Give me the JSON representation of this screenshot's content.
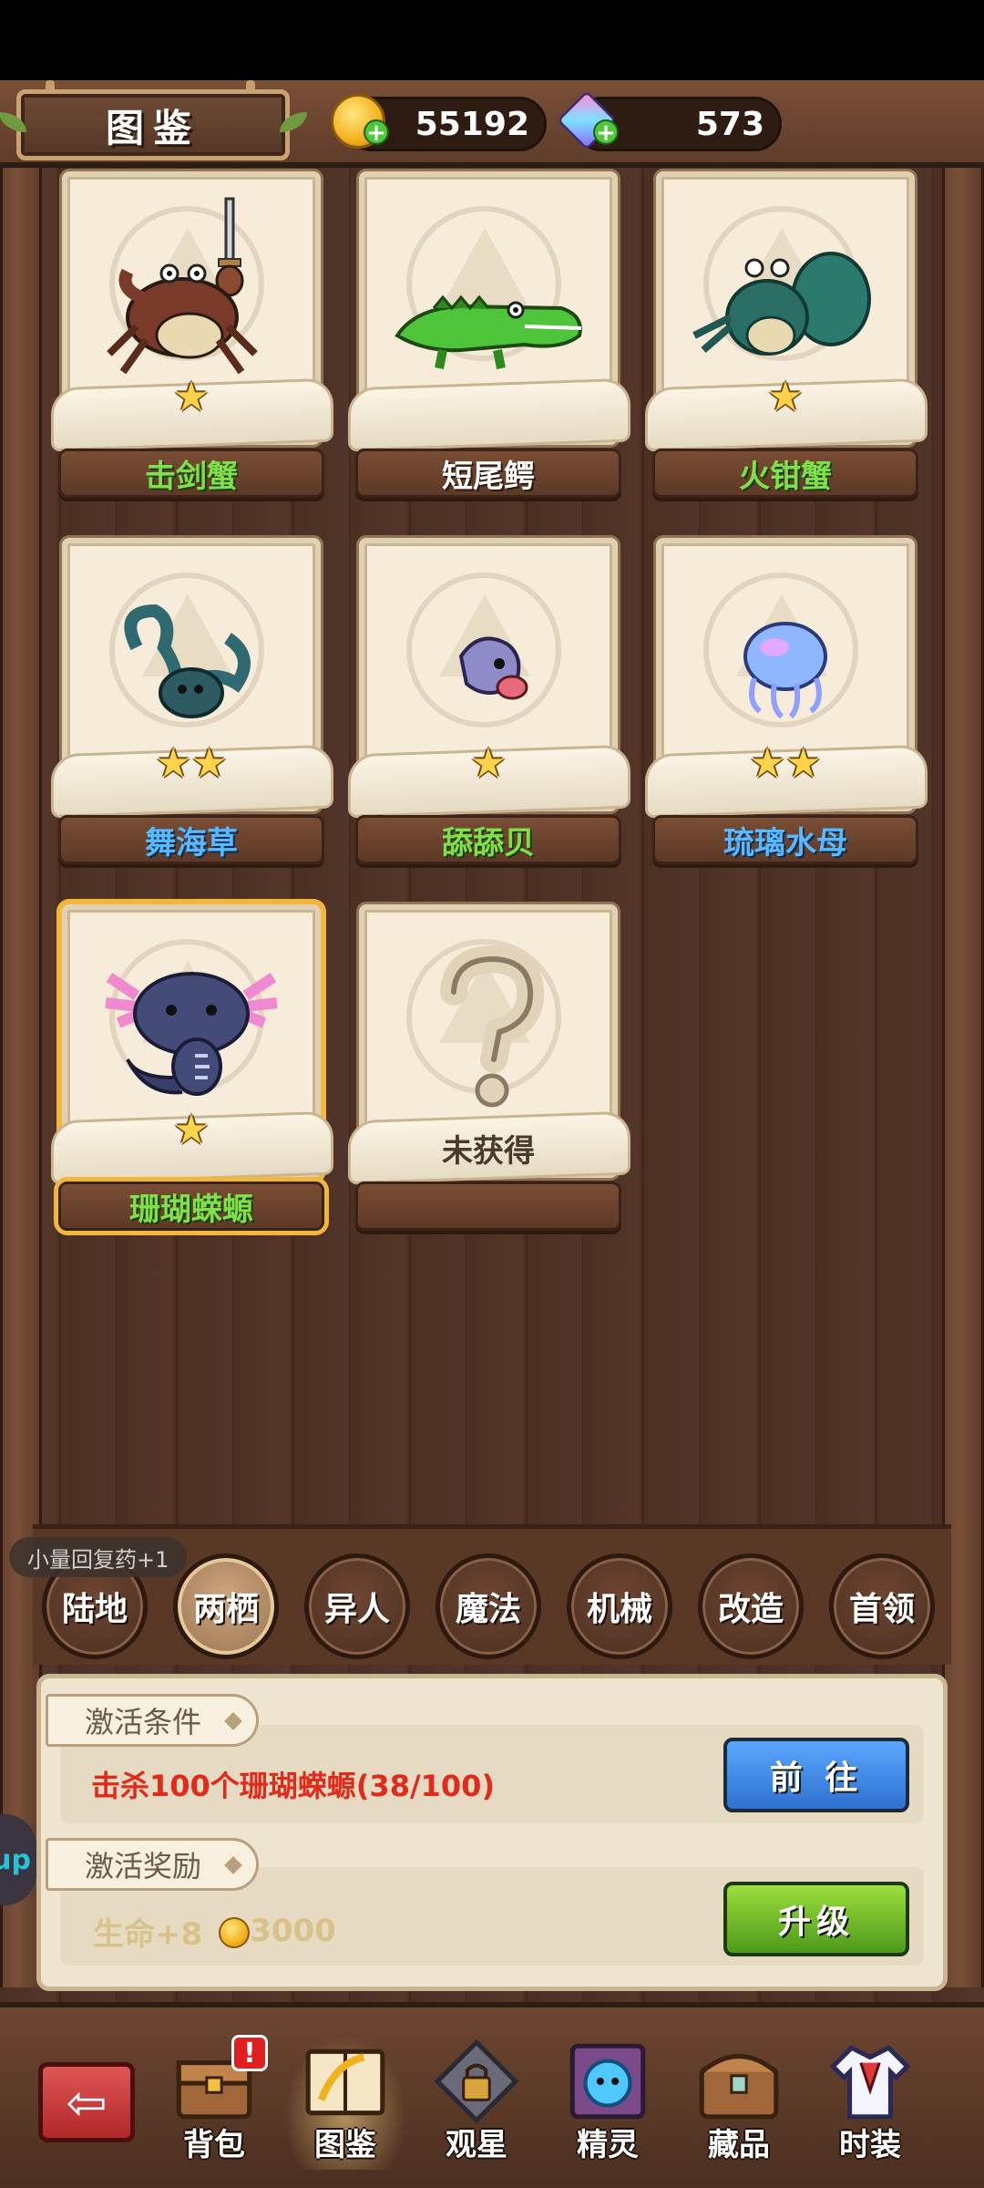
{
  "header": {
    "title": "图鉴",
    "gold": "55192",
    "gems": "573"
  },
  "cards": [
    {
      "name": "击剑蟹",
      "stars": "★",
      "color": "green"
    },
    {
      "name": "短尾鳄",
      "stars": "",
      "color": "white"
    },
    {
      "name": "火钳蟹",
      "stars": "★",
      "color": "green"
    },
    {
      "name": "舞海草",
      "stars": "★★",
      "color": "blue"
    },
    {
      "name": "舔舔贝",
      "stars": "★",
      "color": "green"
    },
    {
      "name": "琉璃水母",
      "stars": "★★",
      "color": "blue"
    },
    {
      "name": "珊瑚蝾螈",
      "stars": "★",
      "color": "green",
      "selected": true
    },
    {
      "name": "未获得",
      "stars": "",
      "color": "locked"
    }
  ],
  "toast": "小量回复药+1",
  "categories": [
    "陆地",
    "两栖",
    "异人",
    "魔法",
    "机械",
    "改造",
    "首领"
  ],
  "active_category": "两栖",
  "panel": {
    "condition_label": "激活条件",
    "condition_text": "击杀100个珊瑚蝾螈(38/100)",
    "goto_button": "前 往",
    "reward_label": "激活奖励",
    "reward_hp": "生命+8",
    "reward_gold": "3000",
    "upgrade_button": "升级"
  },
  "side_bubble": "up",
  "bottom_nav": [
    {
      "label": "背包",
      "icon": "chest-icon",
      "alert": "!"
    },
    {
      "label": "图鉴",
      "icon": "book-icon",
      "active": true
    },
    {
      "label": "观星",
      "icon": "lock-icon"
    },
    {
      "label": "精灵",
      "icon": "spirit-icon"
    },
    {
      "label": "藏品",
      "icon": "treasure-chest-icon"
    },
    {
      "label": "时装",
      "icon": "costume-icon"
    }
  ]
}
